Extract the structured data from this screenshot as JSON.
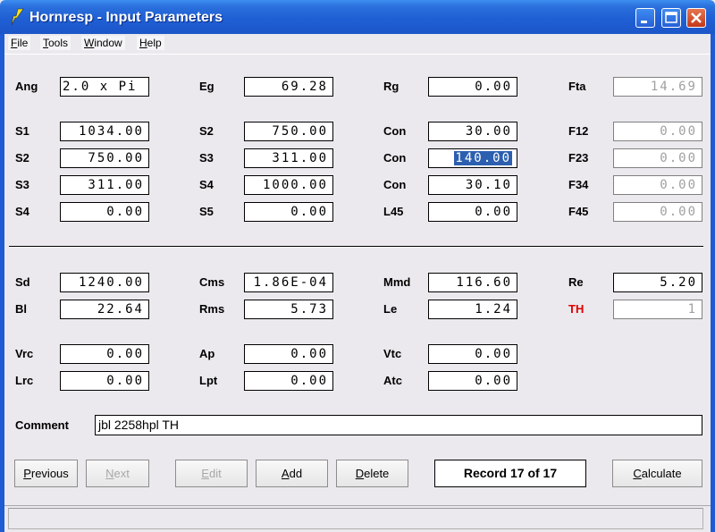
{
  "window": {
    "title": "Hornresp - Input Parameters",
    "controls": {
      "minimize": "minimize-icon",
      "maximize": "maximize-icon",
      "close": "close-icon"
    }
  },
  "menu": [
    {
      "label": "File",
      "accel": "F"
    },
    {
      "label": "Tools",
      "accel": "T"
    },
    {
      "label": "Window",
      "accel": "W"
    },
    {
      "label": "Help",
      "accel": "H"
    }
  ],
  "params": {
    "row0": [
      {
        "label": "Ang",
        "value": "2.0 x Pi"
      },
      {
        "label": "Eg",
        "value": "69.28"
      },
      {
        "label": "Rg",
        "value": "0.00"
      },
      {
        "label": "Fta",
        "value": "14.69",
        "disabled": true
      }
    ],
    "row1": [
      {
        "label": "S1",
        "value": "1034.00"
      },
      {
        "label": "S2",
        "value": "750.00"
      },
      {
        "label": "Con",
        "value": "30.00"
      },
      {
        "label": "F12",
        "value": "0.00",
        "disabled": true
      }
    ],
    "row2": [
      {
        "label": "S2",
        "value": "750.00"
      },
      {
        "label": "S3",
        "value": "311.00"
      },
      {
        "label": "Con",
        "value": "140.00",
        "selected": true
      },
      {
        "label": "F23",
        "value": "0.00",
        "disabled": true
      }
    ],
    "row3": [
      {
        "label": "S3",
        "value": "311.00"
      },
      {
        "label": "S4",
        "value": "1000.00"
      },
      {
        "label": "Con",
        "value": "30.10"
      },
      {
        "label": "F34",
        "value": "0.00",
        "disabled": true
      }
    ],
    "row4": [
      {
        "label": "S4",
        "value": "0.00"
      },
      {
        "label": "S5",
        "value": "0.00"
      },
      {
        "label": "L45",
        "value": "0.00"
      },
      {
        "label": "F45",
        "value": "0.00",
        "disabled": true
      }
    ],
    "row5": [
      {
        "label": "Sd",
        "value": "1240.00"
      },
      {
        "label": "Cms",
        "value": "1.86E-04"
      },
      {
        "label": "Mmd",
        "value": "116.60"
      },
      {
        "label": "Re",
        "value": "5.20"
      }
    ],
    "row6": [
      {
        "label": "Bl",
        "value": "22.64"
      },
      {
        "label": "Rms",
        "value": "5.73"
      },
      {
        "label": "Le",
        "value": "1.24"
      },
      {
        "label": "TH",
        "value": "1",
        "disabled": true,
        "label_color": "#e00000"
      }
    ],
    "row7": [
      {
        "label": "Vrc",
        "value": "0.00"
      },
      {
        "label": "Ap",
        "value": "0.00"
      },
      {
        "label": "Vtc",
        "value": "0.00"
      }
    ],
    "row8": [
      {
        "label": "Lrc",
        "value": "0.00"
      },
      {
        "label": "Lpt",
        "value": "0.00"
      },
      {
        "label": "Atc",
        "value": "0.00"
      }
    ]
  },
  "comment": {
    "label": "Comment",
    "value": "jbl 2258hpl TH"
  },
  "buttons": {
    "previous": "Previous",
    "next": "Next",
    "edit": "Edit",
    "add": "Add",
    "delete": "Delete",
    "calculate": "Calculate"
  },
  "record": "Record 17 of 17",
  "colors": {
    "titlebar": "#1f5fd4",
    "selection": "#2d5fb0",
    "th_label": "#e00000",
    "close_button": "#c2381a"
  }
}
